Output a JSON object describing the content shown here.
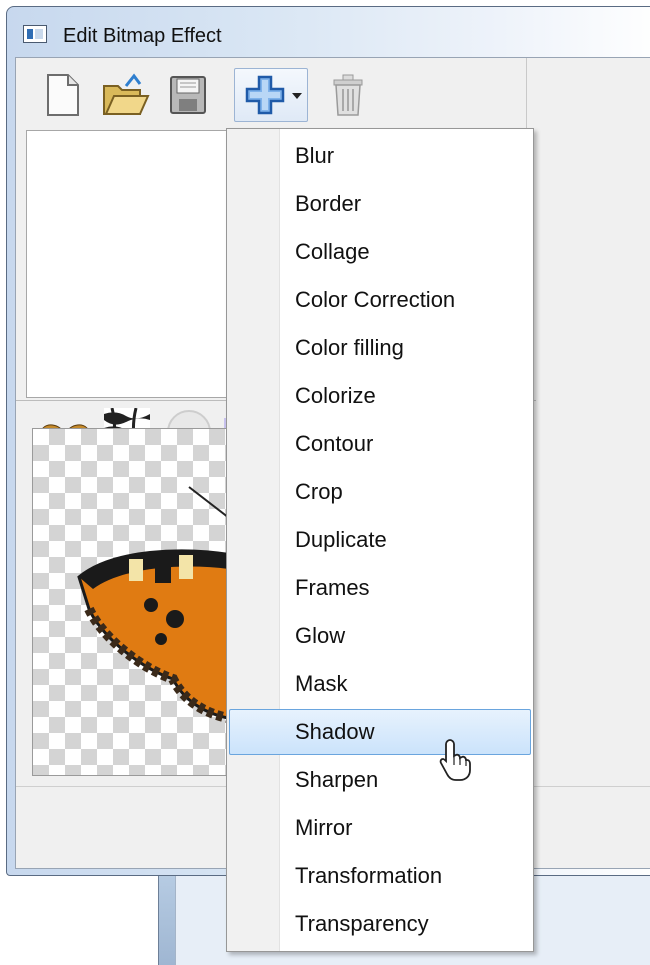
{
  "window": {
    "title": "Edit Bitmap Effect"
  },
  "toolbar": {
    "buttons": [
      {
        "icon": "new-document-icon"
      },
      {
        "icon": "open-folder-icon"
      },
      {
        "icon": "save-disk-icon"
      },
      {
        "icon": "add-effect-icon",
        "has_dropdown": true
      },
      {
        "icon": "trash-icon"
      }
    ]
  },
  "preview_tools": [
    {
      "icon": "butterfly-icon"
    },
    {
      "icon": "zebra-pattern-icon"
    },
    {
      "icon": "circle-icon"
    }
  ],
  "menu": {
    "items": [
      {
        "label": "Blur"
      },
      {
        "label": "Border"
      },
      {
        "label": "Collage"
      },
      {
        "label": "Color Correction"
      },
      {
        "label": "Color filling"
      },
      {
        "label": "Colorize"
      },
      {
        "label": "Contour"
      },
      {
        "label": "Crop"
      },
      {
        "label": "Duplicate"
      },
      {
        "label": "Frames"
      },
      {
        "label": "Glow"
      },
      {
        "label": "Mask"
      },
      {
        "label": "Shadow",
        "highlighted": true
      },
      {
        "label": "Sharpen"
      },
      {
        "label": "Mirror"
      },
      {
        "label": "Transformation"
      },
      {
        "label": "Transparency"
      }
    ]
  },
  "colors": {
    "menu_highlight": "#cbe3fb",
    "menu_highlight_border": "#6aa5de",
    "add_icon": "#2f6fc4"
  }
}
